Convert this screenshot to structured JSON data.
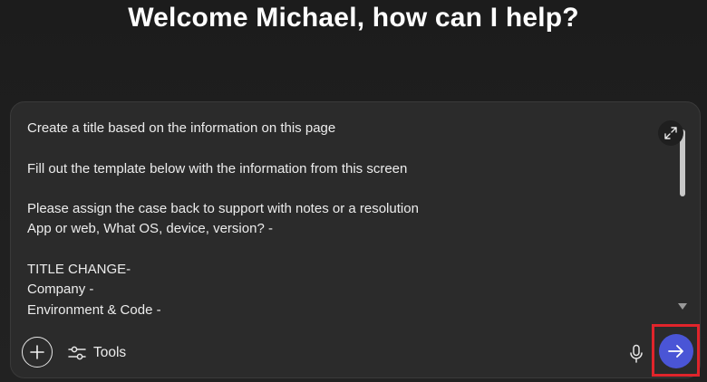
{
  "header": {
    "welcome_text": "Welcome Michael, how can I help?"
  },
  "composer": {
    "prompt_lines": [
      "Create a title based on the information on this page",
      "",
      "Fill out the template below with the information from this screen",
      "",
      "Please assign the case back to support with notes or a resolution",
      "App or web, What OS, device, version? -",
      "",
      "TITLE CHANGE-",
      "Company -",
      "Environment & Code -"
    ],
    "tools_label": "Tools",
    "icons": {
      "expand": "expand-icon",
      "add": "plus-icon",
      "tools": "sliders-icon",
      "mic": "microphone-icon",
      "send": "arrow-right-icon"
    }
  },
  "colors": {
    "send_button": "#4a55d6",
    "highlight": "#e0242b",
    "background": "#1f1f1f",
    "composer_bg": "#2b2b2b"
  }
}
